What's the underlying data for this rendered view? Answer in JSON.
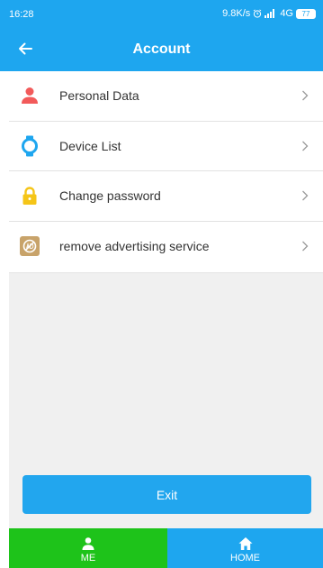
{
  "status": {
    "time": "16:28",
    "network_speed": "9.8K/s",
    "network_type": "4G",
    "battery": "77"
  },
  "header": {
    "title": "Account"
  },
  "menu": {
    "items": [
      {
        "label": "Personal Data",
        "icon": "person-icon"
      },
      {
        "label": "Device List",
        "icon": "watch-icon"
      },
      {
        "label": "Change password",
        "icon": "lock-icon"
      },
      {
        "label": "remove advertising service",
        "icon": "no-ad-icon"
      }
    ]
  },
  "actions": {
    "exit_label": "Exit"
  },
  "bottom_nav": {
    "items": [
      {
        "label": "ME",
        "icon": "person-icon",
        "active": true
      },
      {
        "label": "HOME",
        "icon": "home-icon",
        "active": false
      }
    ]
  },
  "colors": {
    "primary": "#1ea6ef",
    "active_tab": "#1ec31a",
    "person_icon": "#f25a5a",
    "watch_icon": "#1ea6ef",
    "lock_icon": "#f5c518",
    "no_ad_icon": "#c8a36a"
  }
}
